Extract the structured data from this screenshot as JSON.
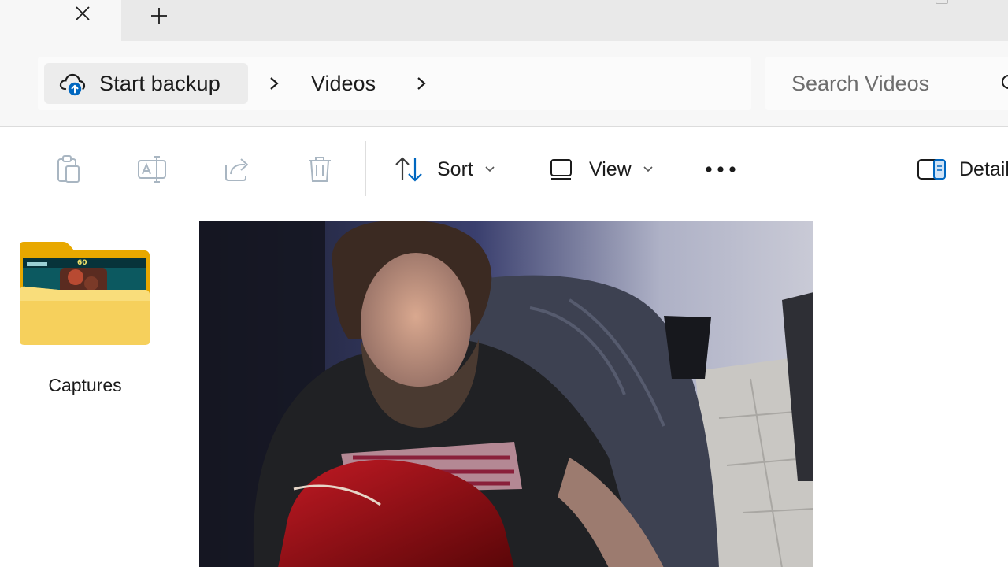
{
  "tabs": {
    "close_icon": "close-icon",
    "new_tab_icon": "plus-icon"
  },
  "address_bar": {
    "backup_label": "Start backup",
    "backup_icon": "cloud-upload-icon",
    "breadcrumb": [
      "Videos"
    ],
    "search_placeholder": "Search Videos"
  },
  "toolbar": {
    "icons": [
      "paste-icon",
      "rename-icon",
      "share-icon",
      "delete-icon"
    ],
    "sort_label": "Sort",
    "view_label": "View",
    "more_icon": "more-icon",
    "details_label": "Details"
  },
  "content": {
    "folders": [
      {
        "name": "Captures",
        "thumbnail_badge": "60"
      }
    ],
    "files": [
      {
        "type": "video",
        "preview": "webcam-recording-thumbnail"
      }
    ]
  },
  "colors": {
    "accent": "#0067c0",
    "folder": "#f5c542",
    "tabstrip": "#e9e9e9",
    "addressrow": "#f7f7f7"
  }
}
